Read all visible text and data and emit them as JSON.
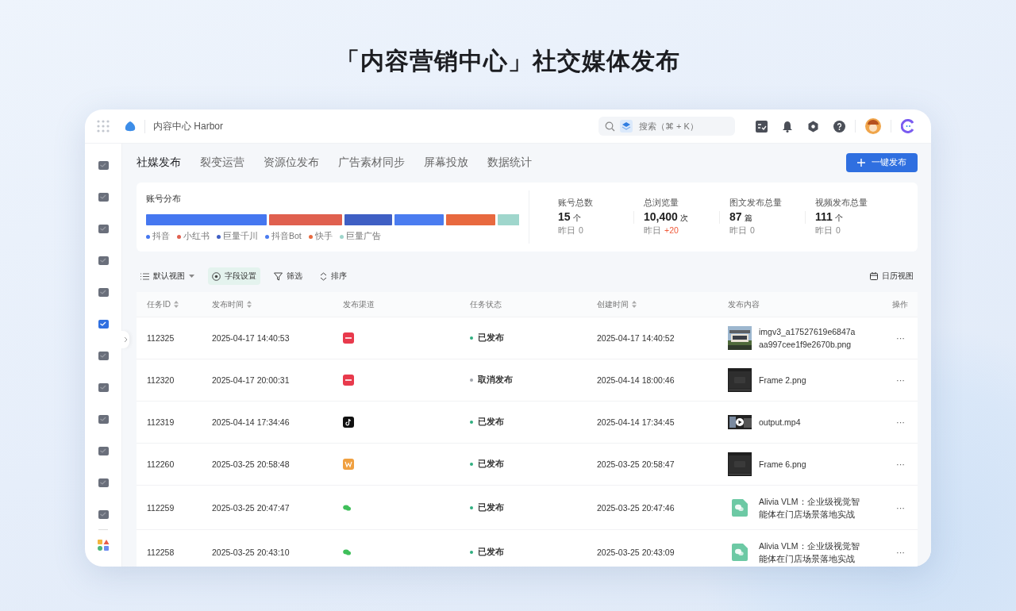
{
  "headline": "「内容营销中心」社交媒体发布",
  "app": {
    "name": "内容中心 Harbor",
    "search": {
      "placeholder": "搜索（⌘ + K）"
    }
  },
  "sidebar": {
    "items": [
      {
        "selected": false
      },
      {
        "selected": false
      },
      {
        "selected": false
      },
      {
        "selected": false
      },
      {
        "selected": false
      },
      {
        "selected": true
      },
      {
        "selected": false
      },
      {
        "selected": false
      },
      {
        "selected": false
      },
      {
        "selected": false
      },
      {
        "selected": false
      },
      {
        "selected": false
      }
    ]
  },
  "tabs": [
    {
      "label": "社媒发布",
      "selected": true
    },
    {
      "label": "裂变运营",
      "selected": false
    },
    {
      "label": "资源位发布",
      "selected": false
    },
    {
      "label": "广告素材同步",
      "selected": false
    },
    {
      "label": "屏幕投放",
      "selected": false
    },
    {
      "label": "数据统计",
      "selected": false
    }
  ],
  "publish_button": "一键发布",
  "distribution": {
    "title": "账号分布",
    "segments": [
      {
        "name": "抖音",
        "color": "#4577f0"
      },
      {
        "name": "小红书",
        "color": "#e0604f"
      },
      {
        "name": "巨量千川",
        "color": "#3f5fc4"
      },
      {
        "name": "抖音Bot",
        "color": "#4a7cf0"
      },
      {
        "name": "快手",
        "color": "#e8693f"
      },
      {
        "name": "巨量广告",
        "color": "#9fd6cc"
      }
    ]
  },
  "stats": [
    {
      "label": "账号总数",
      "value": "15",
      "unit": "个",
      "sub": "昨日",
      "delta": {
        "text": "0",
        "kind": "flat"
      }
    },
    {
      "label": "总浏览量",
      "value": "10,400",
      "unit": "次",
      "sub": "昨日",
      "delta": {
        "text": "+20",
        "kind": "up"
      }
    },
    {
      "label": "图文发布总量",
      "value": "87",
      "unit": "篇",
      "sub": "昨日",
      "delta": {
        "text": "0",
        "kind": "flat"
      }
    },
    {
      "label": "视频发布总量",
      "value": "111",
      "unit": "个",
      "sub": "昨日",
      "delta": {
        "text": "0",
        "kind": "flat"
      }
    }
  ],
  "toolbar": {
    "view": "默认视图",
    "actions": [
      {
        "label": "字段设置",
        "kind": "fields",
        "selected": true
      },
      {
        "label": "筛选",
        "kind": "filter",
        "selected": false
      },
      {
        "label": "排序",
        "kind": "sort",
        "selected": false
      }
    ],
    "calendar": "日历视图"
  },
  "table": {
    "columns": [
      {
        "label": "任务ID",
        "sortable": true
      },
      {
        "label": "发布时间",
        "sortable": true
      },
      {
        "label": "发布渠道",
        "sortable": false
      },
      {
        "label": "任务状态",
        "sortable": false
      },
      {
        "label": "创建时间",
        "sortable": true
      },
      {
        "label": "发布内容",
        "sortable": false
      },
      {
        "label": "操作",
        "sortable": false
      }
    ],
    "rows": [
      {
        "id": "112325",
        "published": "2025-04-17 14:40:53",
        "channel": {
          "kind": "xiaohongshu"
        },
        "status": {
          "label": "已发布",
          "color": "#2fae7f"
        },
        "created": "2025-04-17 14:40:52",
        "content": {
          "name": "imgv3_a17527619e6847a aa997cee1f9e2670b.png"
        },
        "action": "···"
      },
      {
        "id": "112320",
        "published": "2025-04-17 20:00:31",
        "channel": {
          "kind": "xiaohongshu"
        },
        "status": {
          "label": "取消发布",
          "color": "#a0a4ab"
        },
        "created": "2025-04-14 18:00:46",
        "content": {
          "kind": "frame",
          "name": "Frame 2.png"
        },
        "action": "···"
      },
      {
        "id": "112319",
        "published": "2025-04-14 17:34:46",
        "channel": {
          "kind": "douyin"
        },
        "status": {
          "label": "已发布",
          "color": "#2fae7f"
        },
        "created": "2025-04-14 17:34:45",
        "content": {
          "kind": "video",
          "name": "output.mp4"
        },
        "action": "···"
      },
      {
        "id": "112260",
        "published": "2025-03-25 20:58:48",
        "channel": {
          "kind": "kuaishou"
        },
        "status": {
          "label": "已发布",
          "color": "#2fae7f"
        },
        "created": "2025-03-25 20:58:47",
        "content": {
          "kind": "frame",
          "name": "Frame 6.png"
        },
        "action": "···"
      },
      {
        "id": "112259",
        "published": "2025-03-25 20:47:47",
        "channel": {
          "kind": "wechat"
        },
        "status": {
          "label": "已发布",
          "color": "#2fae7f"
        },
        "created": "2025-03-25 20:47:46",
        "content": {
          "kind": "article",
          "name": "Alivia VLM：企业级视觉智能体在门店场景落地实战"
        },
        "action": "···"
      },
      {
        "id": "112258",
        "published": "2025-03-25 20:43:10",
        "channel": {
          "kind": "wechat"
        },
        "status": {
          "label": "已发布",
          "color": "#2fae7f"
        },
        "created": "2025-03-25 20:43:09",
        "content": {
          "kind": "article",
          "name": "Alivia VLM：企业级视觉智能体在门店场景落地实战"
        },
        "action": "···"
      }
    ]
  }
}
